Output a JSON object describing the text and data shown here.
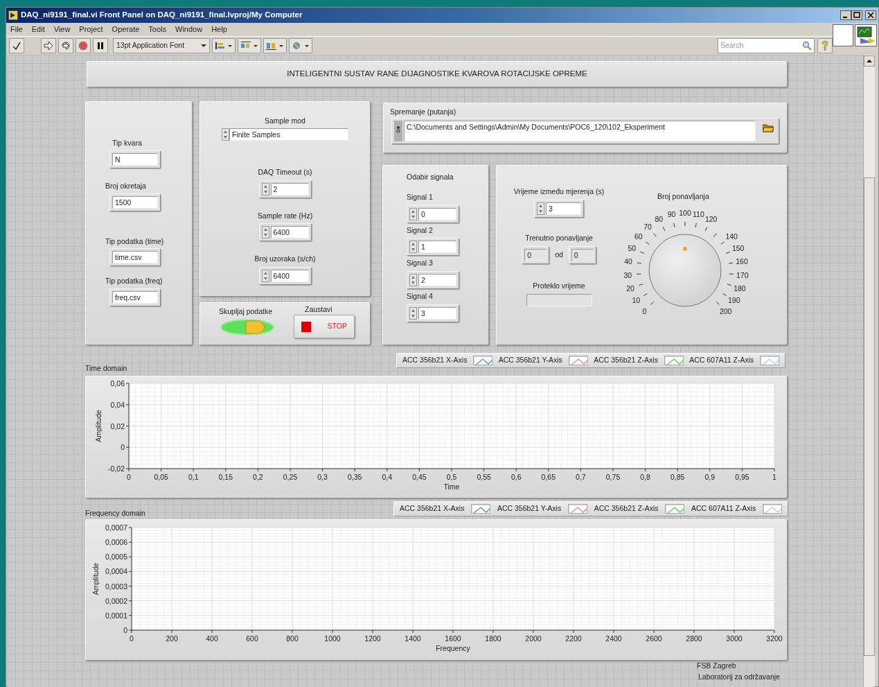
{
  "window": {
    "title": "DAQ_ni9191_final.vi Front Panel on DAQ_ni9191_final.lvproj/My Computer"
  },
  "menu": [
    "File",
    "Edit",
    "View",
    "Project",
    "Operate",
    "Tools",
    "Window",
    "Help"
  ],
  "toolbar": {
    "font": "13pt Application Font",
    "search": {
      "placeholder": "Search"
    }
  },
  "header": {
    "title": "INTELIGENTNI SUSTAV RANE DIJAGNOSTIKE KVAROVA ROTACIJSKE OPREME"
  },
  "parameters": [
    {
      "label": "Tip kvara",
      "value": "N"
    },
    {
      "label": "Broj okretaja",
      "value": "1500"
    },
    {
      "label": "Tip podatka (time)",
      "value": "time.csv"
    },
    {
      "label": "Tip podatka (freq)",
      "value": "freq.csv"
    }
  ],
  "acquisition": {
    "sample_mode": {
      "label": "Sample mod",
      "value": "Finite Samples"
    },
    "numerics": [
      {
        "label": "DAQ Timeout (s)",
        "value": "2"
      },
      {
        "label": "Sample rate (Hz)",
        "value": "6400"
      },
      {
        "label": "Broj uzoraka (s/ch)",
        "value": "6400"
      }
    ]
  },
  "controls": {
    "collect": {
      "label": "Skupljaj podatke",
      "on": true
    },
    "stop": {
      "label": "Zaustavi",
      "text": "STOP"
    }
  },
  "save_path": {
    "label": "Spremanje (putanja)",
    "value": "C:\\Documents and Settings\\Admin\\My Documents\\POC6_120\\102_Eksperiment"
  },
  "signals": {
    "title": "Odabir signala",
    "items": [
      {
        "label": "Signal 1",
        "value": "0"
      },
      {
        "label": "Signal 2",
        "value": "1"
      },
      {
        "label": "Signal 3",
        "value": "2"
      },
      {
        "label": "Signal 4",
        "value": "3"
      }
    ]
  },
  "timing": {
    "interval": {
      "label": "Vrijeme između mjerenja (s)",
      "value": "3"
    },
    "current": {
      "label": "Trenutno ponavljanje",
      "value": "0",
      "separator": "od",
      "total": "0"
    },
    "elapsed": {
      "label": "Proteklo vrijeme"
    },
    "dial": {
      "label": "Broj ponavljanja",
      "scale": [
        "90",
        "100",
        "110",
        "80",
        "120",
        "70",
        "60",
        "140",
        "50",
        "150",
        "40",
        "160",
        "30",
        "170",
        "20",
        "180",
        "10",
        "190",
        "0",
        "200"
      ]
    }
  },
  "time_chart": {
    "title": "Time domain",
    "chart_data": {
      "type": "line",
      "grid": true,
      "xlabel": "Time",
      "ylabel": "Amplitude",
      "ylim": [
        -0.02,
        0.06
      ],
      "categories": [
        "0",
        "0,05",
        "0,1",
        "0,15",
        "0,2",
        "0,25",
        "0,3",
        "0,35",
        "0,4",
        "0,45",
        "0,5",
        "0,55",
        "0,6",
        "0,65",
        "0,7",
        "0,75",
        "0,8",
        "0,85",
        "0,9",
        "0,95",
        "1"
      ],
      "yticks": [
        {
          "value": -0.02,
          "label": "-0,02"
        },
        {
          "value": 0,
          "label": "0"
        },
        {
          "value": 0.02,
          "label": "0,02"
        },
        {
          "value": 0.04,
          "label": "0,04"
        },
        {
          "value": 0.06,
          "label": "0,06"
        }
      ],
      "series": [
        {
          "name": "ACC 356b21 X-Axis",
          "color": "#4a8ed0",
          "values": [
            null,
            null,
            null,
            null,
            null,
            null,
            null,
            null,
            null,
            null,
            null,
            null,
            null,
            null,
            null,
            null,
            null,
            null,
            null,
            null,
            null
          ]
        },
        {
          "name": "ACC 356b21 Y-Axis",
          "color": "#f08080",
          "values": [
            null,
            null,
            null,
            null,
            null,
            null,
            null,
            null,
            null,
            null,
            null,
            null,
            null,
            null,
            null,
            null,
            null,
            null,
            null,
            null,
            null
          ]
        },
        {
          "name": "ACC 356b21 Z-Axis",
          "color": "#40e040",
          "values": [
            null,
            null,
            null,
            null,
            null,
            null,
            null,
            null,
            null,
            null,
            null,
            null,
            null,
            null,
            null,
            null,
            null,
            null,
            null,
            null,
            null
          ]
        },
        {
          "name": "ACC 607A11 Z-Axis",
          "color": "#a0d0f0",
          "values": [
            null,
            null,
            null,
            null,
            null,
            null,
            null,
            null,
            null,
            null,
            null,
            null,
            null,
            null,
            null,
            null,
            null,
            null,
            null,
            null,
            null
          ]
        }
      ]
    }
  },
  "freq_chart": {
    "title": "Frequency domain",
    "chart_data": {
      "type": "line",
      "grid": true,
      "xlabel": "Frequency",
      "ylabel": "Amplitude",
      "ylim": [
        0,
        0.0007
      ],
      "categories": [
        "0",
        "200",
        "400",
        "600",
        "800",
        "1000",
        "1200",
        "1400",
        "1600",
        "1800",
        "2000",
        "2200",
        "2400",
        "2600",
        "2800",
        "3000",
        "3200"
      ],
      "yticks": [
        {
          "value": 0,
          "label": "0"
        },
        {
          "value": 0.0001,
          "label": "0,0001"
        },
        {
          "value": 0.0002,
          "label": "0,0002"
        },
        {
          "value": 0.0003,
          "label": "0,0003"
        },
        {
          "value": 0.0004,
          "label": "0,0004"
        },
        {
          "value": 0.0005,
          "label": "0,0005"
        },
        {
          "value": 0.0006,
          "label": "0,0006"
        },
        {
          "value": 0.0007,
          "label": "0,0007"
        }
      ],
      "series": [
        {
          "name": "ACC 356b21 X-Axis",
          "color": "#4a8ed0",
          "values": [
            null,
            null,
            null,
            null,
            null,
            null,
            null,
            null,
            null,
            null,
            null,
            null,
            null,
            null,
            null,
            null,
            null
          ]
        },
        {
          "name": "ACC 356b21 Y-Axis",
          "color": "#f08080",
          "values": [
            null,
            null,
            null,
            null,
            null,
            null,
            null,
            null,
            null,
            null,
            null,
            null,
            null,
            null,
            null,
            null,
            null
          ]
        },
        {
          "name": "ACC 356b21 Z-Axis",
          "color": "#40e040",
          "values": [
            null,
            null,
            null,
            null,
            null,
            null,
            null,
            null,
            null,
            null,
            null,
            null,
            null,
            null,
            null,
            null,
            null
          ]
        },
        {
          "name": "ACC 607A11 Z-Axis",
          "color": "#a0d0f0",
          "values": [
            null,
            null,
            null,
            null,
            null,
            null,
            null,
            null,
            null,
            null,
            null,
            null,
            null,
            null,
            null,
            null,
            null
          ]
        }
      ]
    }
  },
  "footer": [
    "FSB Zagreb",
    "Laboratorij za održavanje"
  ]
}
